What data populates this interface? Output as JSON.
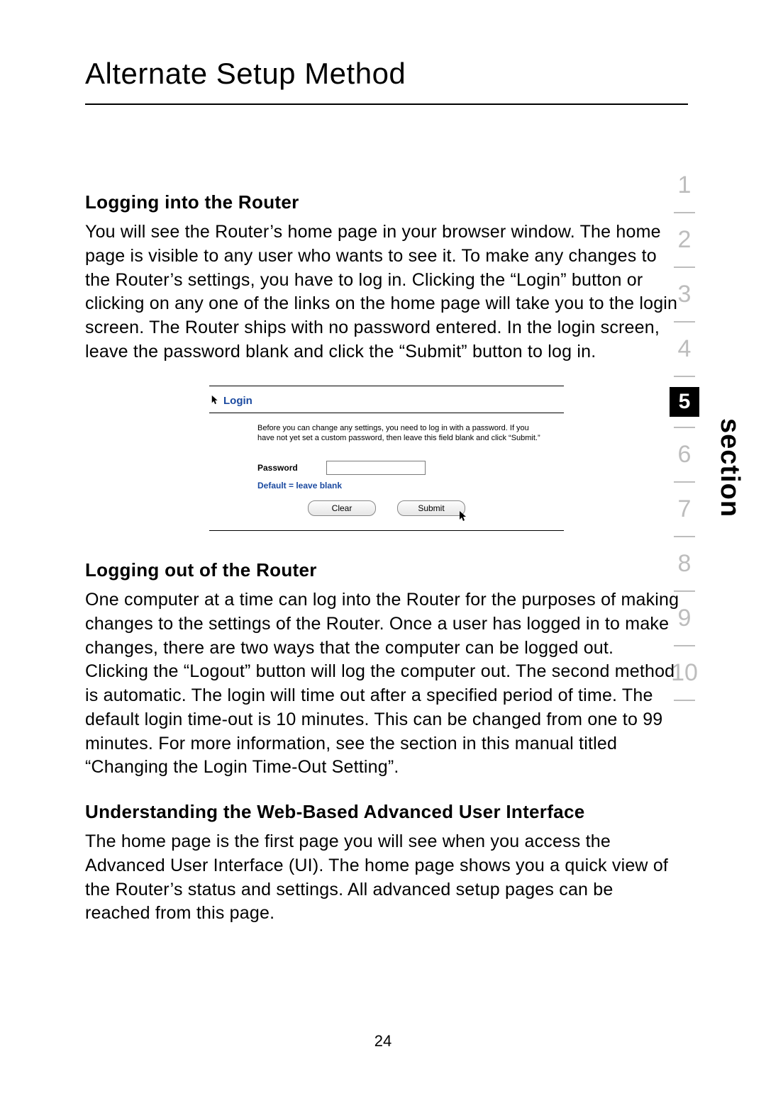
{
  "page_title": "Alternate Setup Method",
  "section_label": "section",
  "section_nav": {
    "items": [
      "1",
      "2",
      "3",
      "4",
      "5",
      "6",
      "7",
      "8",
      "9",
      "10"
    ],
    "active_index": 4
  },
  "blocks": [
    {
      "heading": "Logging into the Router",
      "paragraph": "You will see the Router’s home page in your browser window. The home page is visible to any user who wants to see it. To make any changes to the Router’s settings, you have to log in. Clicking the “Login” button or clicking on any one of the links on the home page will take you to the login screen. The Router ships with no password entered. In the login screen, leave the password blank and click the “Submit” button to log in."
    },
    {
      "heading": "Logging out of the Router",
      "paragraph": "One computer at a time can log into the Router for the purposes of making changes to the settings of the Router. Once a user has logged in to make changes, there are two ways that the computer can be logged out. Clicking the “Logout” button will log the computer out. The second method is automatic. The login will time out after a specified period of time. The default login time-out is 10 minutes. This can be changed from one to 99 minutes. For more information, see the section in this manual titled “Changing the Login Time-Out Setting”."
    },
    {
      "heading": "Understanding the Web-Based Advanced User Interface",
      "paragraph": "The home page is the first page you will see when you access the Advanced User Interface (UI). The home page shows you a quick view of the Router’s status and settings. All advanced setup pages can be reached from this page."
    }
  ],
  "login_box": {
    "link_label": "Login",
    "instructions": "Before you can change any settings, you need to log in with a password. If you have not yet set a custom password, then leave this field blank and click “Submit.”",
    "password_label": "Password",
    "password_value": "",
    "default_hint": "Default = leave blank",
    "clear_label": "Clear",
    "submit_label": "Submit"
  },
  "page_number": "24"
}
